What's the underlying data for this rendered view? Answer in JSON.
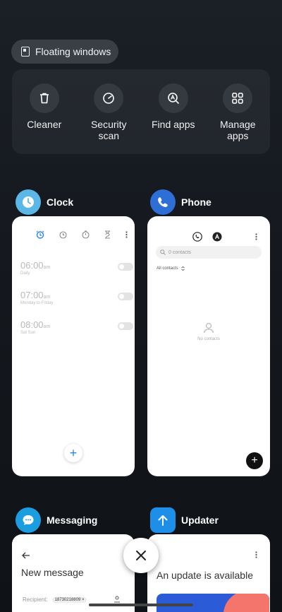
{
  "floating": {
    "label": "Floating windows"
  },
  "tools": [
    {
      "label": "Cleaner",
      "icon": "trash-icon"
    },
    {
      "label": "Security scan",
      "icon": "security-icon"
    },
    {
      "label": "Find apps",
      "icon": "find-apps-icon"
    },
    {
      "label": "Manage apps",
      "icon": "grid-icon"
    }
  ],
  "apps": {
    "clock": {
      "name": "Clock",
      "color": "#5bb8e6",
      "alarms": [
        {
          "time": "06:00",
          "ampm": "am",
          "repeat": "Daily"
        },
        {
          "time": "07:00",
          "ampm": "am",
          "repeat": "Monday to Friday"
        },
        {
          "time": "08:00",
          "ampm": "am",
          "repeat": "Sat Sun"
        }
      ],
      "add": "+"
    },
    "phone": {
      "name": "Phone",
      "color": "#2d6fd6",
      "search_placeholder": "0 contacts",
      "filter": "All contacts",
      "empty": "No contacts",
      "add": "+"
    },
    "messaging": {
      "name": "Messaging",
      "color": "#1b9ee0",
      "title": "New message",
      "recipient_label": "Recipient:",
      "recipient_value": "18730218809"
    },
    "updater": {
      "name": "Updater",
      "color": "#1e8fe8",
      "title": "An update is available"
    }
  },
  "close": {
    "icon": "close-icon"
  }
}
